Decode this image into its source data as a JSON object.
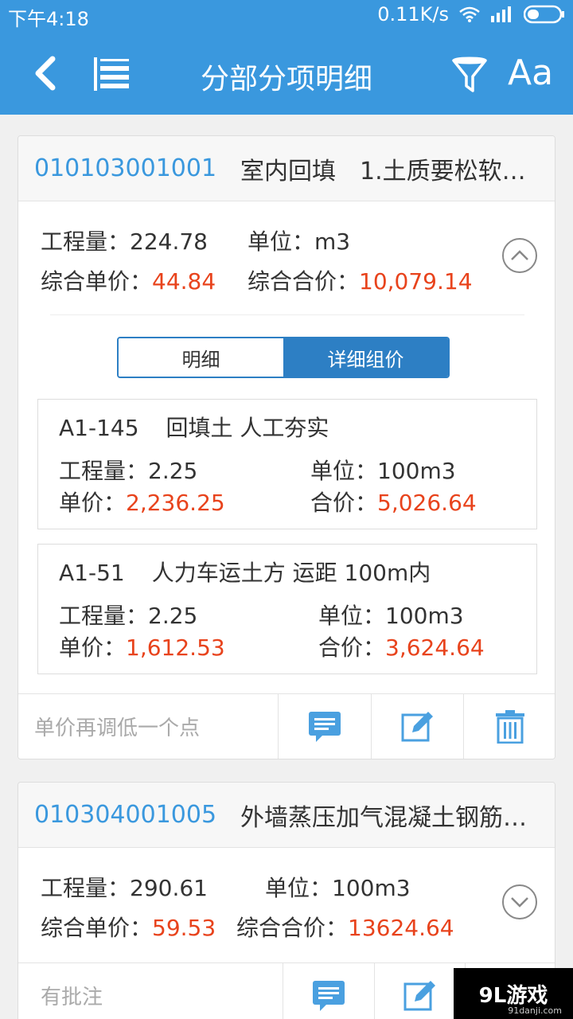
{
  "status": {
    "time": "下午4:18",
    "speed": "0.11K/s"
  },
  "appbar": {
    "title": "分部分项明细",
    "font_label": "Aa"
  },
  "labels": {
    "qty": "工程量：",
    "unit": "单位：",
    "comp_unit_price": "综合单价：",
    "comp_total": "综合合价：",
    "unit_price": "单价：",
    "total": "合价："
  },
  "items": [
    {
      "code": "010103001001",
      "name": "室内回填　1.土质要松软…",
      "qty": "224.78",
      "unit": "m3",
      "unit_price": "44.84",
      "total": "10,079.14",
      "expanded": true,
      "segment": {
        "left": "明细",
        "right": "详细组价",
        "selected": "right"
      },
      "details": [
        {
          "code": "A1-145",
          "name": "回填土 人工夯实",
          "qty": "2.25",
          "unit": "100m3",
          "unit_price": "2,236.25",
          "total": "5,026.64"
        },
        {
          "code": "A1-51",
          "name": "人力车运土方 运距 100m内",
          "qty": "2.25",
          "unit": "100m3",
          "unit_price": "1,612.53",
          "total": "3,624.64"
        }
      ],
      "note": "单价再调低一个点"
    },
    {
      "code": "010304001005",
      "name": "外墙蒸压加气混凝土钢筋…",
      "qty": "290.61",
      "unit": "100m3",
      "unit_price": "59.53",
      "total": "13624.64",
      "expanded": false,
      "note": "有批注"
    }
  ],
  "watermark": {
    "text": "9L游戏",
    "sub": "91danji.com"
  },
  "colors": {
    "brand": "#3a98de",
    "price": "#e8431c",
    "segment": "#2d7fc4"
  }
}
